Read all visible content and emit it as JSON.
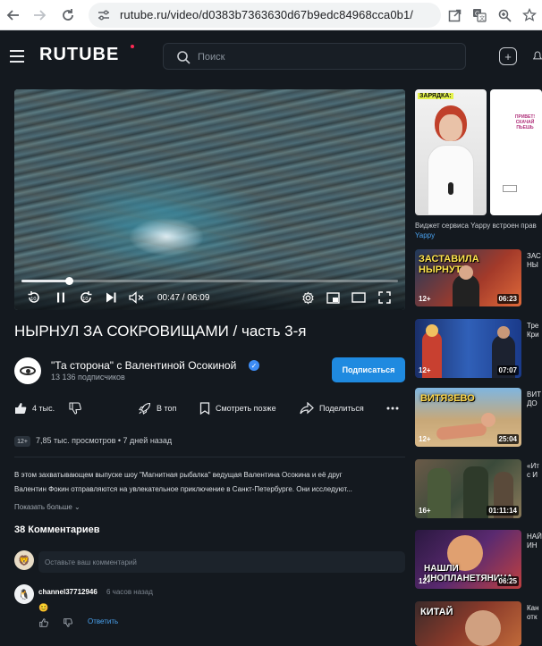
{
  "browser": {
    "url": "rutube.ru/video/d0383b7363630d67b9edc84968cca0b1/"
  },
  "header": {
    "logo": "RUTUBE",
    "search_placeholder": "Поиск"
  },
  "player": {
    "time": "00:47 / 06:09",
    "progress": 0.127
  },
  "video": {
    "title": "НЫРНУЛ ЗА СОКРОВИЩАМИ / часть 3-я",
    "channel_name": "\"Та сторона\" с Валентиной Осокиной",
    "subscribers": "13 136 подписчиков",
    "subscribe_label": "Подписаться",
    "likes": "4 тыс.",
    "top_label": "В топ",
    "watch_later_label": "Смотреть позже",
    "share_label": "Поделиться",
    "age_rating": "12+",
    "views_date": "7,85 тыс. просмотров  •  7 дней назад",
    "description_line1": "В этом захватывающем выпуске шоу \"Магнитная рыбалка\" ведущая Валентина Осокина и её друг",
    "description_line2": "Валентин Фокин отправляются на увлекательное приключение в Санкт-Петербурге. Они исследуют...",
    "show_more": "Показать больше"
  },
  "comments": {
    "count_label": "38 Комментариев",
    "input_placeholder": "Оставьте ваш комментарий",
    "items": [
      {
        "author": "channel37712946",
        "time": "6 часов назад",
        "text": "😊",
        "reply_label": "Ответить"
      }
    ]
  },
  "sidebar": {
    "yappy_caption": "Виджет сервиса Yappy встроен прав",
    "yappy_link": "Yappy",
    "yappy_card1_text": "ЗАРЯДКА:",
    "yappy_card2_text": "ПРИВЕТ! СКАЧАЙ ПЬЕШЬ",
    "items": [
      {
        "caption": "ЗАСТАВИЛА НЫРНУТЬ",
        "badge": "12+",
        "duration": "06:23",
        "title": "ЗАС",
        "sub": "НЫ"
      },
      {
        "caption": "",
        "badge": "12+",
        "duration": "07:07",
        "title": "Тре",
        "sub": "Кри"
      },
      {
        "caption": "ВИТЯЗЕВО",
        "badge": "12+",
        "duration": "25:04",
        "title": "ВИТ",
        "sub": "ДО"
      },
      {
        "caption": "",
        "badge": "16+",
        "duration": "01:11:14",
        "title": "«Ит",
        "sub": "с И"
      },
      {
        "caption": "НАШЛИ ИНОПЛАНЕТЯНИНА",
        "badge": "12+",
        "duration": "06:25",
        "title": "НАЙ",
        "sub": "ИН"
      },
      {
        "caption": "КИТАЙ",
        "badge": "",
        "duration": "",
        "title": "Кан",
        "sub": "отк"
      }
    ]
  }
}
